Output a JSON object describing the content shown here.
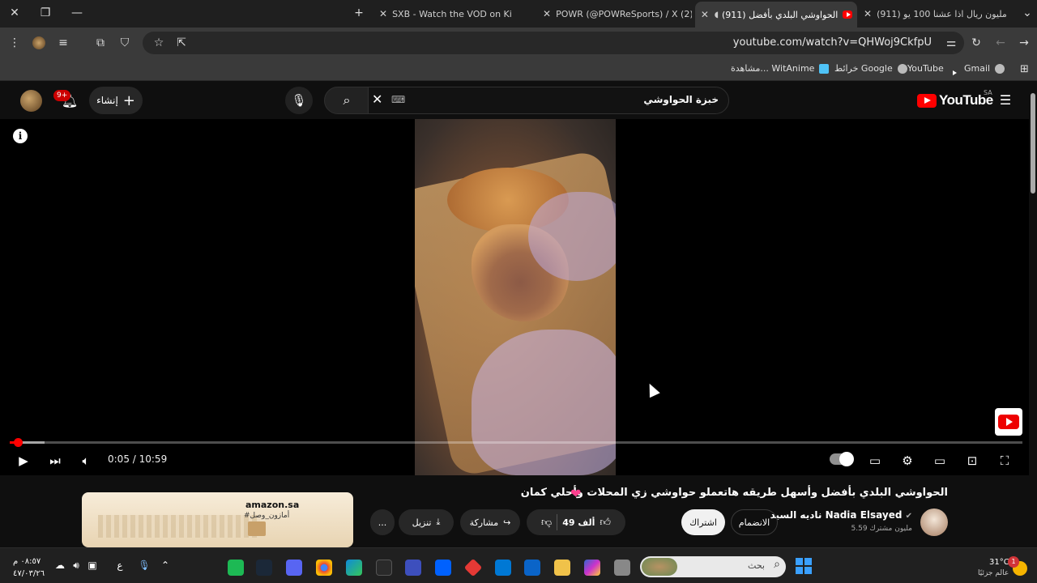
{
  "browser": {
    "tabs": [
      {
        "title": "(911) مليون ريال اذا عشنا 100 يو",
        "active": false
      },
      {
        "title": "(911) الحواوشي البلدي بأفضل",
        "active": true
      },
      {
        "title": "POWR (@POWReSports) / X (2)",
        "active": false
      },
      {
        "title": "SXB - Watch the VOD on Kick",
        "active": false
      }
    ],
    "new_tab": "+",
    "url": "youtube.com/watch?v=QHWoj9CkfpU",
    "bookmarks": [
      {
        "label": "Gmail"
      },
      {
        "label": "YouTube"
      },
      {
        "label": "خرائط Google"
      },
      {
        "label": "مشاهدة... WitAnime"
      }
    ]
  },
  "youtube": {
    "logo_text": "YouTube",
    "country": "SA",
    "search_value": "خبزة الحواوشي",
    "create_label": "إنشاء",
    "notifications_badge": "9+",
    "player": {
      "time_current": "0:05",
      "time_total": "10:59",
      "time_display": "0:05 / 10:59",
      "progress_fraction": 0.0076,
      "buffer_fraction": 0.034
    },
    "video": {
      "title": "الحواوشي البلدي بأفضل وأسهل طريقه هاتعملو حواوشي زي المحلات وأحلي كمان",
      "channel_name": "ناديه السيد Nadia Elsayed",
      "subscribers": "5.59 مليون مشترك",
      "join_label": "الانضمام",
      "subscribe_label": "اشتراك",
      "likes": "49 ألف",
      "share_label": "مشاركة",
      "download_label": "تنزيل",
      "more_label": "..."
    },
    "ad": {
      "brand": "amazon.sa",
      "tagline": "#أمازون_وصل"
    }
  },
  "taskbar": {
    "search_placeholder": "بحث",
    "weather_temp": "31°C",
    "weather_desc": "عالم جزئيًا",
    "weather_badge": "1",
    "clock_time": "٠٨:٥٧ م",
    "clock_date": "٤٧/٠٣/٢٦",
    "lang": "ع"
  },
  "colors": {
    "youtube_red": "#ff0000",
    "page_bg": "#0f0f0f",
    "heart": "#ff3f8e"
  }
}
